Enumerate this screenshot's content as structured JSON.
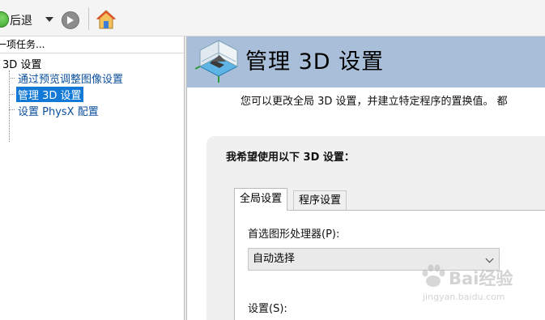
{
  "toolbar": {
    "back_label": "后退",
    "back_icon": "back-arrow-icon",
    "forward_icon": "forward-arrow-icon",
    "home_icon": "home-icon"
  },
  "tree": {
    "header": "一项任务...",
    "root_label": "3D 设置",
    "items": [
      {
        "label": "通过预览调整图像设置",
        "selected": false
      },
      {
        "label": "管理 3D 设置",
        "selected": true
      },
      {
        "label": "设置 PhysX 配置",
        "selected": false
      }
    ]
  },
  "main": {
    "title": "管理 3D 设置",
    "description": "您可以更改全局 3D 设置，并建立特定程序的置换值。 都",
    "panel_title": "我希望使用以下 3D 设置：",
    "tabs": [
      {
        "label": "全局设置",
        "active": true
      },
      {
        "label": "程序设置",
        "active": false
      }
    ],
    "processor_label": "首选图形处理器(P):",
    "processor_value": "自动选择",
    "settings_label": "设置(S):"
  },
  "watermark": {
    "text": "Bai经验",
    "url": "jingyan.baidu.com"
  },
  "colors": {
    "banner": "#a9bfd9",
    "selection": "#1279d6",
    "tree_link": "#0a4f9c"
  }
}
